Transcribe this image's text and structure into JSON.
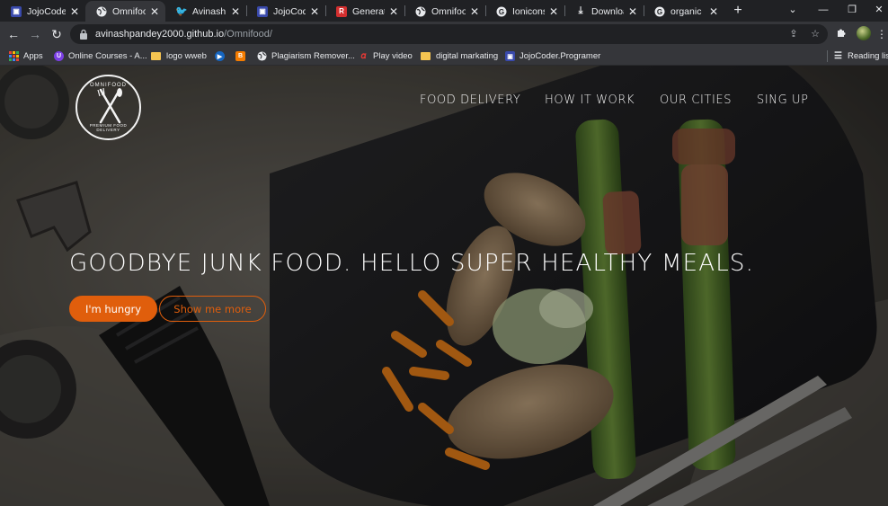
{
  "browser": {
    "tabs": [
      {
        "label": "JojoCoder",
        "favicon": "jojocoder-favicon",
        "active": false
      },
      {
        "label": "Omnifood",
        "favicon": "globe-icon",
        "active": true
      },
      {
        "label": "Avinash pa",
        "favicon": "twitter-icon",
        "active": false
      },
      {
        "label": "JojoCoder",
        "favicon": "jojocoder-favicon",
        "active": false
      },
      {
        "label": "Generate y",
        "favicon": "generator-favicon",
        "active": false
      },
      {
        "label": "Omnifood",
        "favicon": "globe-icon",
        "active": false
      },
      {
        "label": "Ionicons U",
        "favicon": "google-icon",
        "active": false
      },
      {
        "label": "Download",
        "favicon": "download-icon",
        "active": false
      },
      {
        "label": "organic icc",
        "favicon": "google-icon",
        "active": false
      }
    ],
    "url_host": "avinashpandey2000.github.io",
    "url_path": "/Omnifood/",
    "bookmarks": [
      {
        "label": "Apps",
        "icon": "apps-grid-icon"
      },
      {
        "label": "Online Courses - A...",
        "icon": "courses-favicon"
      },
      {
        "label": "logo wweb",
        "icon": "folder-icon"
      },
      {
        "label": "",
        "icon": "play-favicon"
      },
      {
        "label": "",
        "icon": "blogger-favicon"
      },
      {
        "label": "Plagiarism Remover...",
        "icon": "globe-icon"
      },
      {
        "label": "Play video",
        "icon": "video-favicon"
      },
      {
        "label": "digital markating",
        "icon": "folder-icon"
      },
      {
        "label": "JojoCoder.Programer",
        "icon": "jojocoder-favicon"
      }
    ],
    "reading_list": "Reading list"
  },
  "site": {
    "logo": {
      "brand": "OMNIFOOD",
      "tagline": "PREMIUM FOOD DELIVERY"
    },
    "nav": [
      "FOOD DELIVERY",
      "HOW IT WORK",
      "OUR CITIES",
      "SING UP"
    ],
    "headline": "GOODBYE JUNK FOOD. HELLO SUPER HEALTHY MEALS.",
    "cta_primary": "I'm hungry",
    "cta_secondary": "Show me more"
  },
  "colors": {
    "accent": "#e05e0c",
    "chrome_dark": "#202124",
    "chrome_toolbar": "#35363a"
  }
}
